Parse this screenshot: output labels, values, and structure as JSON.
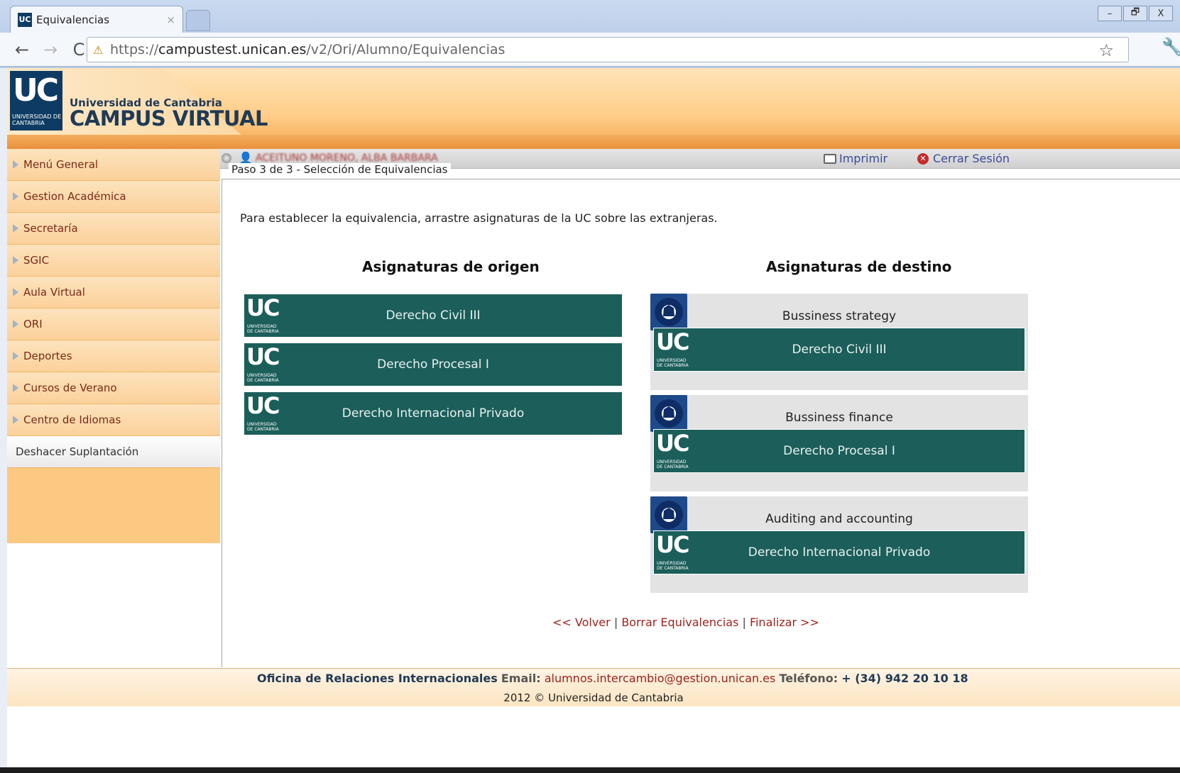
{
  "browser": {
    "tab_title": "Equivalencias",
    "tab_close": "×",
    "favicon": "UC",
    "url_scheme": "https://",
    "url_host": "campustest.unican.es",
    "url_path": "/v2/Ori/Alumno/Equivalencias",
    "controls": {
      "minimize": "–",
      "restore": "🗗",
      "close": "X"
    },
    "back": "←",
    "forward": "→",
    "reload": "C",
    "star": "☆",
    "wrench": "🔧"
  },
  "header": {
    "logo_big": "UC",
    "logo_small": "UNIVERSIDAD DE CANTABRIA",
    "university": "Universidad de Cantabria",
    "campus": "CAMPUS VIRTUAL"
  },
  "sidebar": {
    "items": [
      {
        "label": "Menú General"
      },
      {
        "label": "Gestion Académica"
      },
      {
        "label": "Secretaría"
      },
      {
        "label": "SGIC"
      },
      {
        "label": "Aula Virtual"
      },
      {
        "label": "ORI"
      },
      {
        "label": "Deportes"
      },
      {
        "label": "Cursos de Verano"
      },
      {
        "label": "Centro de Idiomas"
      }
    ],
    "undo": "Deshacer Suplantación"
  },
  "userbar": {
    "user_name": "ACEITUNO MORENO, ALBA BARBARA",
    "print": "Imprimir",
    "logout": "Cerrar Sesión"
  },
  "main": {
    "legend": "Paso 3 de 3 - Selección de Equivalencias",
    "instructions": "Para establecer la equivalencia, arrastre asignaturas de la UC sobre las extranjeras.",
    "origin_title": "Asignaturas de origen",
    "dest_title": "Asignaturas de destino",
    "origin": [
      {
        "label": "Derecho Civil III"
      },
      {
        "label": "Derecho Procesal I"
      },
      {
        "label": "Derecho Internacional Privado"
      }
    ],
    "destination": [
      {
        "foreign": "Bussiness strategy",
        "uc": "Derecho Civil III"
      },
      {
        "foreign": "Bussiness finance",
        "uc": "Derecho Procesal I"
      },
      {
        "foreign": "Auditing and accounting",
        "uc": "Derecho Internacional Privado"
      }
    ],
    "actions": {
      "back": "<< Volver",
      "clear": "Borrar Equivalencias",
      "finish": "Finalizar >>",
      "sep": "|"
    }
  },
  "footer": {
    "office": "Oficina de Relaciones Internacionales",
    "email_label": "Email:",
    "email": "alumnos.intercambio@gestion.unican.es",
    "phone_label": "Teléfono:",
    "phone": "+ (34) 942 20 10 18",
    "copyright": "2012 © Universidad de Cantabria"
  },
  "colors": {
    "card": "#1b5e5a",
    "header_orange": "#ffcd88",
    "link": "#a0231e"
  }
}
